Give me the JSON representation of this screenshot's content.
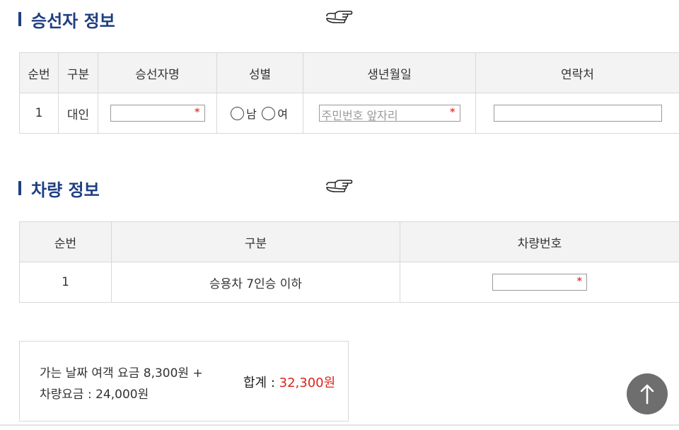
{
  "passenger_section": {
    "title": "승선자 정보",
    "headers": [
      "순번",
      "구분",
      "승선자명",
      "성별",
      "생년월일",
      "연락처"
    ],
    "row": {
      "no": "1",
      "type": "대인",
      "name_value": "",
      "gender_options": [
        "남",
        "여"
      ],
      "birth_placeholder": "주민번호 앞자리",
      "contact_value": ""
    }
  },
  "vehicle_section": {
    "title": "차량 정보",
    "headers": [
      "순번",
      "구분",
      "차량번호"
    ],
    "row": {
      "no": "1",
      "type": "승용차 7인승 이하",
      "plate_value": ""
    }
  },
  "summary": {
    "line1_label": "가는 날짜 여객 요금",
    "line1_amount": "8,300원 +",
    "line2": "차량요금 : 24,000원",
    "total_label": "합계 :",
    "total_amount": "32,300원"
  },
  "required_mark": "*",
  "colors": {
    "title": "#1f3f82",
    "required": "#e8433b",
    "total": "#d9261c"
  },
  "icons": {
    "pointer": "pointing-hand-icon",
    "scroll_top": "arrow-up-icon"
  }
}
